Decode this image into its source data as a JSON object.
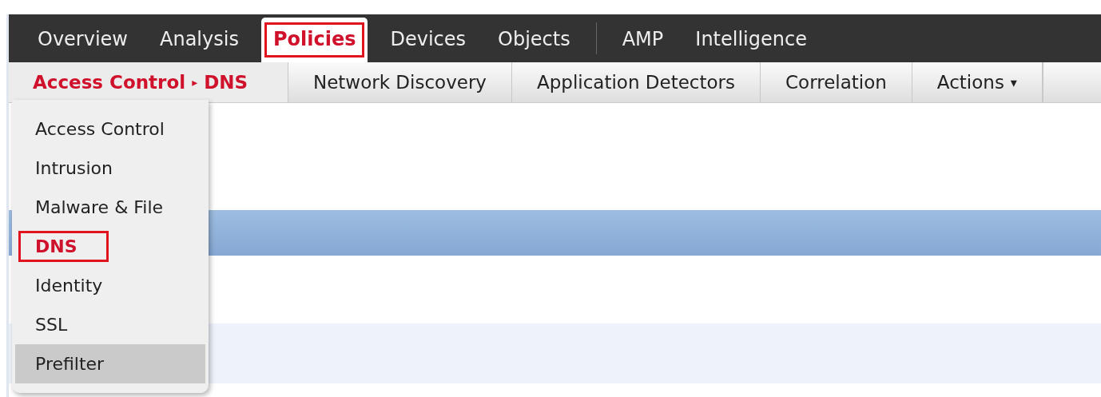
{
  "main_nav": [
    {
      "label": "Overview",
      "selected": false,
      "highlighted": false,
      "divider_before": false
    },
    {
      "label": "Analysis",
      "selected": false,
      "highlighted": false,
      "divider_before": false
    },
    {
      "label": "Policies",
      "selected": true,
      "highlighted": true,
      "divider_before": false
    },
    {
      "label": "Devices",
      "selected": false,
      "highlighted": false,
      "divider_before": false
    },
    {
      "label": "Objects",
      "selected": false,
      "highlighted": false,
      "divider_before": false
    },
    {
      "label": "AMP",
      "selected": false,
      "highlighted": false,
      "divider_before": true
    },
    {
      "label": "Intelligence",
      "selected": false,
      "highlighted": false,
      "divider_before": false
    }
  ],
  "sub_nav": [
    {
      "kind": "breadcrumb",
      "parts": [
        "Access Control",
        "DNS"
      ],
      "separator": "▸",
      "selected": true
    },
    {
      "kind": "tab",
      "label": "Network Discovery",
      "selected": false
    },
    {
      "kind": "tab",
      "label": "Application Detectors",
      "selected": false
    },
    {
      "kind": "tab",
      "label": "Correlation",
      "selected": false
    },
    {
      "kind": "menu",
      "label": "Actions",
      "caret": "▾",
      "selected": false
    }
  ],
  "dropdown": {
    "items": [
      {
        "label": "Access Control",
        "selected": false,
        "highlighted": false,
        "hovered": false
      },
      {
        "label": "Intrusion",
        "selected": false,
        "highlighted": false,
        "hovered": false
      },
      {
        "label": "Malware & File",
        "selected": false,
        "highlighted": false,
        "hovered": false
      },
      {
        "label": "DNS",
        "selected": true,
        "highlighted": true,
        "hovered": false
      },
      {
        "label": "Identity",
        "selected": false,
        "highlighted": false,
        "hovered": false
      },
      {
        "label": "SSL",
        "selected": false,
        "highlighted": false,
        "hovered": false
      },
      {
        "label": "Prefilter",
        "selected": false,
        "highlighted": false,
        "hovered": true
      }
    ]
  },
  "content_rows": [
    {
      "kind": "blank"
    },
    {
      "kind": "header"
    },
    {
      "kind": "blank"
    },
    {
      "kind": "shaded"
    }
  ]
}
